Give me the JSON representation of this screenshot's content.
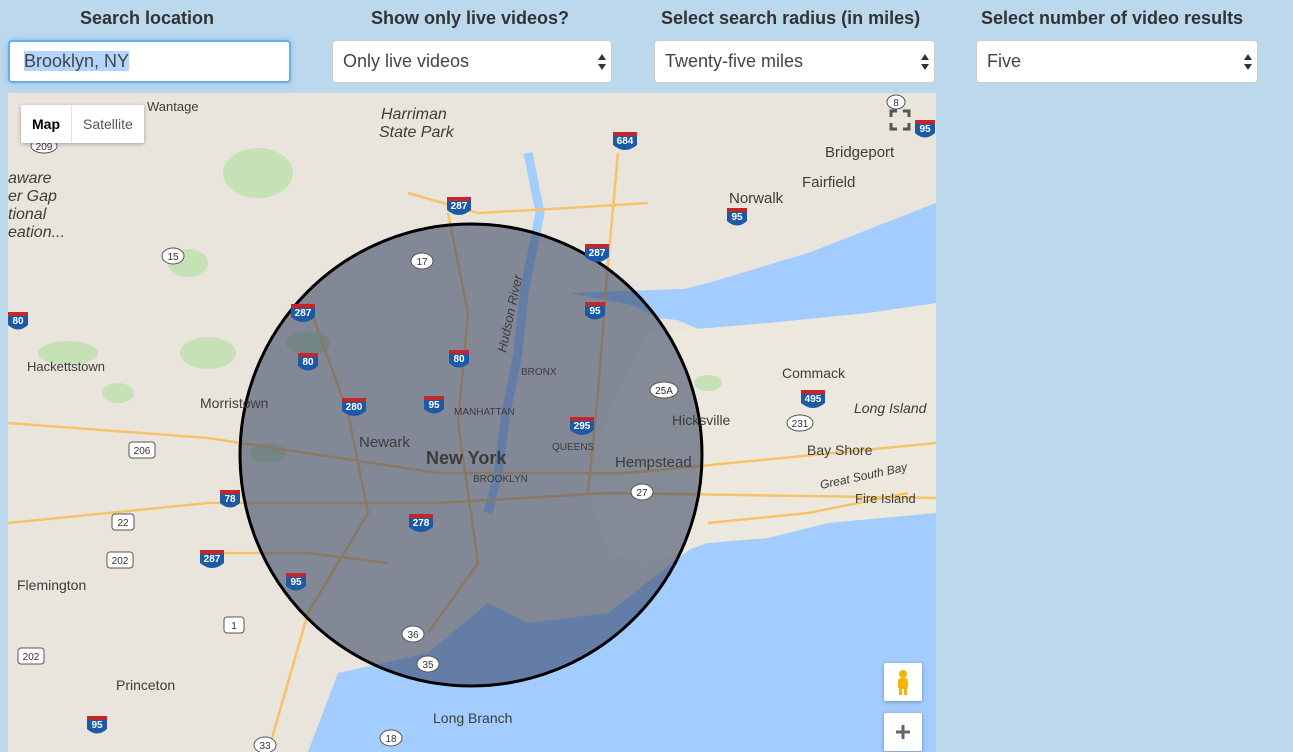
{
  "controls": {
    "location": {
      "label": "Search location",
      "value": "Brooklyn, NY"
    },
    "live": {
      "label": "Show only live videos?",
      "value": "Only live videos"
    },
    "radius": {
      "label": "Select search radius (in miles)",
      "value": "Twenty-five miles"
    },
    "results": {
      "label": "Select number of video results",
      "value": "Five"
    }
  },
  "map": {
    "type_buttons": {
      "map": "Map",
      "satellite": "Satellite"
    },
    "places": {
      "new_york": "New York",
      "newark": "Newark",
      "manhattan": "MANHATTAN",
      "brooklyn": "BROOKLYN",
      "queens": "QUEENS",
      "bronx": "BRONX",
      "hempstead": "Hempstead",
      "hicksville": "Hicksville",
      "commack": "Commack",
      "long_island": "Long Island",
      "bay_shore": "Bay Shore",
      "fire_island": "Fire Island",
      "great_south_bay": "Great South Bay",
      "bridgeport": "Bridgeport",
      "fairfield": "Fairfield",
      "norwalk": "Norwalk",
      "harriman_1": "Harriman",
      "harriman_2": "State Park",
      "wantage": "Wantage",
      "hackettstown": "Hackettstown",
      "morristown": "Morristown",
      "flemington": "Flemington",
      "princeton": "Princeton",
      "long_branch": "Long Branch",
      "hudson_river": "Hudson River",
      "delaware_1": "aware",
      "delaware_2": "er Gap",
      "delaware_3": "tional",
      "delaware_4": "eation..."
    },
    "shields": {
      "i684": "684",
      "i287a": "287",
      "i287b": "287",
      "i287c": "287",
      "i287d": "287",
      "i95a": "95",
      "i95b": "95",
      "i95c": "95",
      "i95d": "95",
      "i95e": "95",
      "i95f": "95",
      "i80a": "80",
      "i80b": "80",
      "i80c": "80",
      "i280": "280",
      "i278": "278",
      "i295": "295",
      "i495": "495",
      "i78": "78",
      "r17": "17",
      "r15": "15",
      "r206": "206",
      "r22": "22",
      "r202a": "202",
      "r202b": "202",
      "r1": "1",
      "r36": "36",
      "r35": "35",
      "r33": "33",
      "r18": "18",
      "r25a": "25A",
      "r27": "27",
      "r231": "231",
      "r209": "209",
      "r8": "8"
    }
  },
  "colors": {
    "accent": "#66afe9",
    "water": "#a3ccff",
    "circle_fill": "#2f3d5c"
  }
}
